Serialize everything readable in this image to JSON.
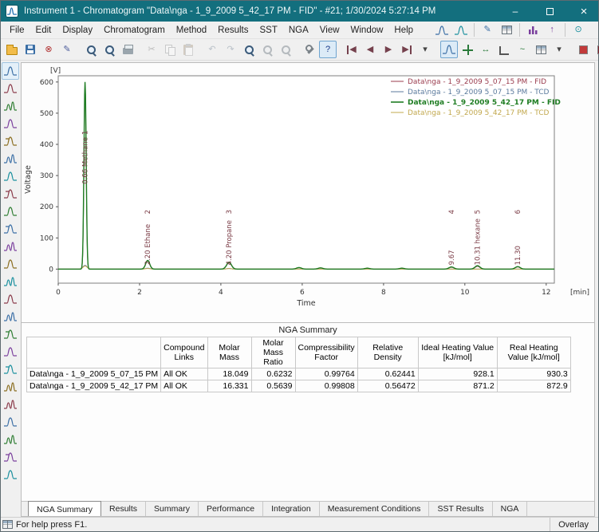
{
  "window": {
    "title": "Instrument 1 - Chromatogram \"Data\\nga - 1_9_2009 5_42_17 PM - FID\" - #21;   1/30/2024   5:27:14 PM",
    "controls": {
      "minimize": "–",
      "close": "×"
    }
  },
  "menubar": {
    "items": [
      "File",
      "Edit",
      "Display",
      "Chromatogram",
      "Method",
      "Results",
      "SST",
      "NGA",
      "View",
      "Window",
      "Help"
    ]
  },
  "menubar_icons": [
    {
      "n": "chart-window-icon",
      "k": "peak",
      "c": "#3a6ea5"
    },
    {
      "n": "chart-monitor-icon",
      "k": "peak",
      "c": "#1a8f9e"
    },
    {
      "sep": true
    },
    {
      "n": "chart-pen-icon",
      "g": "✎",
      "c": "#3a6ea5"
    },
    {
      "n": "results-table-icon",
      "k": "gridt"
    },
    {
      "sep": true
    },
    {
      "n": "column-chart-icon",
      "k": "bars",
      "c": "#7a3f9d"
    },
    {
      "n": "up-arrow-icon",
      "g": "↑",
      "c": "#7a3f9d"
    },
    {
      "sep": true
    },
    {
      "n": "clock-icon",
      "g": "⊙",
      "c": "#1a8f9e"
    }
  ],
  "toolbar": {
    "items": [
      {
        "n": "open-chromatogram-button",
        "k": "folder"
      },
      {
        "n": "save-chromatogram-button",
        "k": "floppy"
      },
      {
        "n": "close-chromatogram-button",
        "g": "⊗",
        "c": "#b03030"
      },
      {
        "n": "report-setup-button",
        "g": "✎",
        "c": "#4a5a9a"
      },
      {
        "sep": true
      },
      {
        "n": "zoom-graph-button",
        "k": "mag"
      },
      {
        "n": "print-preview-button",
        "k": "mag"
      },
      {
        "n": "print-button",
        "k": "printer"
      },
      {
        "sep": true
      },
      {
        "n": "cut-button",
        "g": "✂",
        "c": "#555",
        "d": true
      },
      {
        "n": "copy-button",
        "k": "copy",
        "d": true
      },
      {
        "n": "paste-button",
        "k": "paste",
        "d": true
      },
      {
        "sep": true
      },
      {
        "n": "undo-button",
        "g": "↶",
        "c": "#3a6ea5",
        "d": true
      },
      {
        "n": "redo-button",
        "g": "↷",
        "c": "#3a6ea5",
        "d": true
      },
      {
        "n": "zoom-in-button",
        "k": "mag"
      },
      {
        "n": "zoom-out-button",
        "k": "mag",
        "d": true
      },
      {
        "n": "unzoom-button",
        "k": "mag",
        "d": true
      },
      {
        "sep": true
      },
      {
        "n": "properties-button",
        "k": "wrench"
      },
      {
        "n": "help-button",
        "g": "?",
        "c": "#1a3a8a",
        "s": true
      },
      {
        "sep": true
      },
      {
        "n": "first-chromatogram-button",
        "g": "◀",
        "c": "#75414d",
        "cls": "bl"
      },
      {
        "n": "previous-chromatogram-button",
        "g": "◀",
        "c": "#75414d"
      },
      {
        "n": "next-chromatogram-button",
        "g": "▶",
        "c": "#75414d"
      },
      {
        "n": "last-chromatogram-button",
        "g": "▶",
        "c": "#75414d",
        "cls": "br"
      },
      {
        "n": "chromatogram-list-dropdown",
        "g": "▾",
        "c": "#444"
      },
      {
        "sep": true
      },
      {
        "n": "overlay-mode-toggle",
        "k": "peak",
        "c": "#3a6ea5",
        "s": true
      },
      {
        "n": "move-overlay-button",
        "k": "move"
      },
      {
        "n": "scale-overlay-button",
        "g": "↔",
        "c": "#2a7a3a"
      },
      {
        "n": "common-axes-button",
        "k": "axes"
      },
      {
        "n": "signal-button",
        "g": "~",
        "c": "#2a7a3a"
      },
      {
        "n": "table-columns-button",
        "k": "gridt"
      },
      {
        "n": "table-columns-dropdown",
        "g": "▾",
        "c": "#444"
      },
      {
        "sep": true
      },
      {
        "n": "color-red-swatch",
        "k": "swatch",
        "c": "#c23a3a"
      },
      {
        "n": "color-multi-swatch",
        "k": "swatch-multi"
      },
      {
        "n": "color-green-swatch",
        "k": "swatch",
        "c": "#3a9a3a",
        "s": true
      },
      {
        "n": "color-orange-swatch",
        "k": "swatch",
        "c": "#e0a62c"
      },
      {
        "sep": true
      },
      {
        "n": "dots-style-button",
        "g": "••",
        "c": "#1a9aa0"
      },
      {
        "n": "dash-style-button",
        "g": "—",
        "c": "#7a3f9d"
      }
    ]
  },
  "sidebar": {
    "icons": [
      {
        "name": "signal-tool-icon-1",
        "color": "#3a6ea5",
        "v": 0
      },
      {
        "name": "signal-tool-icon-2",
        "color": "#8a3a4a",
        "v": 0
      },
      {
        "name": "signal-tool-icon-3",
        "color": "#2e7d32",
        "v": 1
      },
      {
        "name": "signal-tool-icon-4",
        "color": "#7a3f9d",
        "v": 0
      },
      {
        "name": "signal-tool-icon-5",
        "color": "#8a6d1f",
        "v": 2
      },
      {
        "name": "signal-tool-icon-6",
        "color": "#3a6ea5",
        "v": 1
      },
      {
        "name": "signal-tool-icon-7",
        "color": "#1a8f9e",
        "v": 0
      },
      {
        "name": "signal-tool-icon-8",
        "color": "#8a3a4a",
        "v": 2
      },
      {
        "name": "signal-tool-icon-9",
        "color": "#2e7d32",
        "v": 0
      },
      {
        "name": "signal-tool-icon-10",
        "color": "#3a6ea5",
        "v": 2
      },
      {
        "name": "signal-tool-icon-11",
        "color": "#7a3f9d",
        "v": 1
      },
      {
        "name": "signal-tool-icon-12",
        "color": "#8a6d1f",
        "v": 0
      },
      {
        "name": "signal-tool-icon-13",
        "color": "#1a8f9e",
        "v": 1
      },
      {
        "name": "signal-tool-icon-14",
        "color": "#8a3a4a",
        "v": 0
      },
      {
        "name": "signal-tool-icon-15",
        "color": "#3a6ea5",
        "v": 1
      },
      {
        "name": "signal-tool-icon-16",
        "color": "#2e7d32",
        "v": 2
      },
      {
        "name": "signal-tool-icon-17",
        "color": "#7a3f9d",
        "v": 0
      },
      {
        "name": "signal-tool-icon-18",
        "color": "#1a8f9e",
        "v": 2
      },
      {
        "name": "signal-tool-icon-19",
        "color": "#8a6d1f",
        "v": 1
      },
      {
        "name": "signal-tool-icon-20",
        "color": "#8a3a4a",
        "v": 1
      },
      {
        "name": "signal-tool-icon-21",
        "color": "#3a6ea5",
        "v": 0
      },
      {
        "name": "signal-tool-icon-22",
        "color": "#2e7d32",
        "v": 1
      },
      {
        "name": "signal-tool-icon-23",
        "color": "#7a3f9d",
        "v": 2
      },
      {
        "name": "signal-tool-icon-24",
        "color": "#1a8f9e",
        "v": 0
      }
    ]
  },
  "chart_data": {
    "type": "line",
    "title": "",
    "xlabel": "Time",
    "x_unit": "[min]",
    "ylabel": "Voltage",
    "y_unit": "[V]",
    "xlim": [
      0,
      12.2
    ],
    "ylim": [
      -45,
      620
    ],
    "x_ticks": [
      0,
      2,
      4,
      6,
      8,
      10,
      12
    ],
    "y_ticks": [
      0,
      100,
      200,
      300,
      400,
      500,
      600
    ],
    "grid": false,
    "legend_position": "top-right",
    "peak_label_color": "#7a3b45",
    "series": [
      {
        "name": "Data\\nga - 1_9_2009 5_07_15 PM - FID",
        "color": "#9a3b4d",
        "bold": false,
        "peaks": [
          [
            0.66,
            590,
            0.026
          ],
          [
            2.2,
            26,
            0.05
          ],
          [
            4.2,
            20,
            0.06
          ],
          [
            5.92,
            5,
            0.06
          ],
          [
            6.45,
            4,
            0.06
          ],
          [
            7.6,
            3,
            0.06
          ],
          [
            8.45,
            3,
            0.06
          ],
          [
            9.67,
            6,
            0.06
          ],
          [
            10.31,
            9,
            0.06
          ],
          [
            11.3,
            7,
            0.06
          ]
        ]
      },
      {
        "name": "Data\\nga - 1_9_2009 5_07_15 PM - TCD",
        "color": "#5b7a9d",
        "bold": false,
        "peaks": [
          [
            0.66,
            12,
            0.05
          ],
          [
            2.2,
            3,
            0.06
          ],
          [
            4.2,
            2,
            0.06
          ]
        ]
      },
      {
        "name": "Data\\nga - 1_9_2009 5_42_17 PM - FID",
        "color": "#1f7d23",
        "bold": true,
        "peaks": [
          [
            0.66,
            600,
            0.027
          ],
          [
            2.2,
            28,
            0.05
          ],
          [
            4.2,
            22,
            0.06
          ],
          [
            5.92,
            5,
            0.06
          ],
          [
            6.45,
            4,
            0.06
          ],
          [
            7.6,
            3,
            0.06
          ],
          [
            8.45,
            3,
            0.06
          ],
          [
            9.67,
            7,
            0.06
          ],
          [
            10.31,
            11,
            0.06
          ],
          [
            11.3,
            8,
            0.06
          ]
        ]
      },
      {
        "name": "Data\\nga - 1_9_2009 5_42_17 PM - TCD",
        "color": "#c2a84e",
        "bold": false,
        "peaks": [
          [
            0.66,
            10,
            0.05
          ],
          [
            2.2,
            2,
            0.06
          ],
          [
            4.2,
            2,
            0.06
          ]
        ]
      }
    ],
    "peak_labels": [
      {
        "rt": 0.66,
        "label": "0.66 Methane",
        "num": "1",
        "tall": true
      },
      {
        "rt": 2.2,
        "label": "2.20 Ethane",
        "num": "2"
      },
      {
        "rt": 4.2,
        "label": "4.20 Propane",
        "num": "3"
      },
      {
        "rt": 9.67,
        "label": "9.67",
        "num": "4"
      },
      {
        "rt": 10.31,
        "label": "10.31 hexane",
        "num": "5"
      },
      {
        "rt": 11.3,
        "label": "11.30",
        "num": "6"
      }
    ]
  },
  "nga_summary": {
    "caption": "NGA Summary",
    "columns": [
      "",
      "Compound Links",
      "Molar Mass",
      "Molar Mass Ratio",
      "Compressibility Factor",
      "Relative Density",
      "Ideal Heating Value [kJ/mol]",
      "Real Heating Value [kJ/mol]"
    ],
    "rows": [
      [
        "Data\\nga - 1_9_2009 5_07_15 PM",
        "All OK",
        "18.049",
        "0.6232",
        "0.99764",
        "0.62441",
        "928.1",
        "930.3"
      ],
      [
        "Data\\nga - 1_9_2009 5_42_17 PM",
        "All OK",
        "16.331",
        "0.5639",
        "0.99808",
        "0.56472",
        "871.2",
        "872.9"
      ]
    ]
  },
  "tabs": {
    "items": [
      "NGA Summary",
      "Results",
      "Summary",
      "Performance",
      "Integration",
      "Measurement Conditions",
      "SST Results",
      "NGA"
    ],
    "active": 0
  },
  "statusbar": {
    "help": "For help press F1.",
    "overlay_label": "Overlay"
  }
}
